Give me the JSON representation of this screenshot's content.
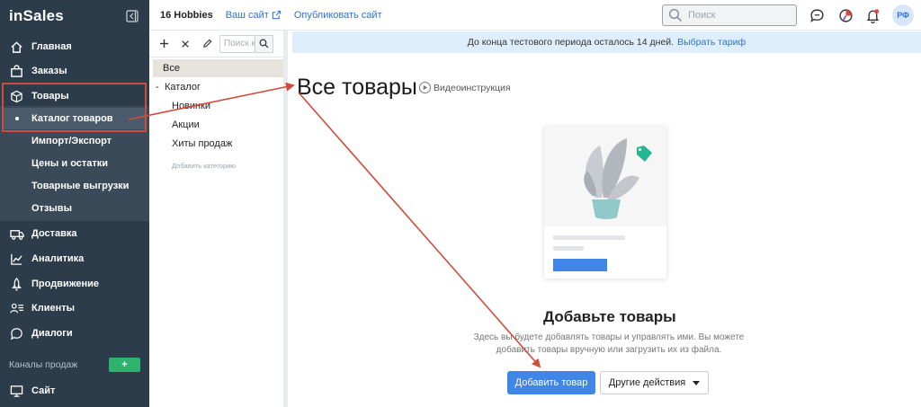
{
  "sidebar": {
    "logo": "inSales",
    "items": [
      {
        "label": "Главная",
        "icon": "home-icon"
      },
      {
        "label": "Заказы",
        "icon": "bag-icon"
      },
      {
        "label": "Товары",
        "icon": "box-icon"
      },
      {
        "label": "Доставка",
        "icon": "truck-icon"
      },
      {
        "label": "Аналитика",
        "icon": "chart-icon"
      },
      {
        "label": "Продвижение",
        "icon": "rocket-icon"
      },
      {
        "label": "Клиенты",
        "icon": "users-icon"
      },
      {
        "label": "Диалоги",
        "icon": "chat-icon"
      }
    ],
    "subitems": [
      {
        "label": "Каталог товаров"
      },
      {
        "label": "Импорт/Экспорт"
      },
      {
        "label": "Цены и остатки"
      },
      {
        "label": "Товарные выгрузки"
      },
      {
        "label": "Отзывы"
      }
    ],
    "channels_label": "Каналы продаж",
    "channels_add": "+",
    "site_label": "Сайт"
  },
  "topbar": {
    "shop_name": "16 Hobbies",
    "your_site": "Ваш сайт",
    "publish": "Опубликовать сайт",
    "search_placeholder": "Поиск",
    "avatar": "РФ"
  },
  "catalog": {
    "search_placeholder": "Поиск к",
    "all": "Все",
    "root": "Каталог",
    "root_toggle": "-",
    "children": [
      "Новинки",
      "Акции",
      "Хиты продаж"
    ],
    "add_category": "Добавить категорию"
  },
  "main": {
    "banner_text": "До конца тестового периода осталось 14 дней.",
    "banner_link": "Выбрать тариф",
    "title": "Все товары",
    "video": "Видеоинструкция",
    "empty_title": "Добавьте товары",
    "empty_desc": "Здесь вы будете добавлять товары и управлять ими. Вы можете добавить товары вручную или загрузить их из файла.",
    "add_button": "Добавить товар",
    "other_actions": "Другие действия"
  },
  "colors": {
    "sidebar_bg": "#2d3c4a",
    "accent_blue": "#3f86e8",
    "annotation_red": "#d14b3c",
    "add_green": "#2db36b",
    "banner_bg": "#dfeefc"
  }
}
